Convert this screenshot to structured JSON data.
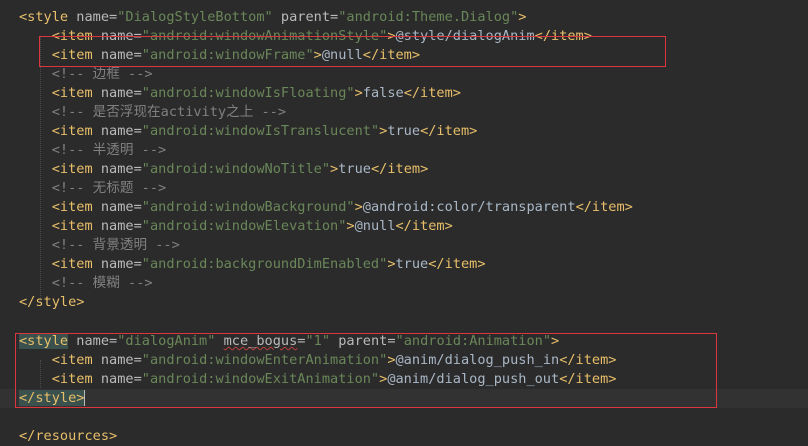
{
  "editor": {
    "lines": [
      {
        "segs": [
          [
            "tag",
            "<style "
          ],
          [
            "attr",
            "name="
          ],
          [
            "val",
            "\"DialogStyleBottom\""
          ],
          [
            "attr",
            " parent="
          ],
          [
            "val",
            "\"android:Theme.Dialog\""
          ],
          [
            "tag",
            ">"
          ]
        ]
      },
      {
        "segs": [
          [
            "ws",
            "    "
          ],
          [
            "tag",
            "<item "
          ],
          [
            "attr",
            "name="
          ],
          [
            "val",
            "\"android:windowAnimationStyle\""
          ],
          [
            "tag",
            ">"
          ],
          [
            "txt",
            "@style/dialogAnim"
          ],
          [
            "tag",
            "</item>"
          ]
        ]
      },
      {
        "segs": [
          [
            "ws",
            "    "
          ],
          [
            "tag",
            "<item "
          ],
          [
            "attr",
            "name="
          ],
          [
            "val",
            "\"android:windowFrame\""
          ],
          [
            "tag",
            ">"
          ],
          [
            "txt",
            "@null"
          ],
          [
            "tag",
            "</item>"
          ]
        ]
      },
      {
        "segs": [
          [
            "ws",
            "    "
          ],
          [
            "cmt",
            "<!-- 边框 -->"
          ]
        ]
      },
      {
        "segs": [
          [
            "ws",
            "    "
          ],
          [
            "tag",
            "<item "
          ],
          [
            "attr",
            "name="
          ],
          [
            "val",
            "\"android:windowIsFloating\""
          ],
          [
            "tag",
            ">"
          ],
          [
            "txt",
            "false"
          ],
          [
            "tag",
            "</item>"
          ]
        ]
      },
      {
        "segs": [
          [
            "ws",
            "    "
          ],
          [
            "cmt",
            "<!-- 是否浮现在activity之上 -->"
          ]
        ]
      },
      {
        "segs": [
          [
            "ws",
            "    "
          ],
          [
            "tag",
            "<item "
          ],
          [
            "attr",
            "name="
          ],
          [
            "val",
            "\"android:windowIsTranslucent\""
          ],
          [
            "tag",
            ">"
          ],
          [
            "txt",
            "true"
          ],
          [
            "tag",
            "</item>"
          ]
        ]
      },
      {
        "segs": [
          [
            "ws",
            "    "
          ],
          [
            "cmt",
            "<!-- 半透明 -->"
          ]
        ]
      },
      {
        "segs": [
          [
            "ws",
            "    "
          ],
          [
            "tag",
            "<item "
          ],
          [
            "attr",
            "name="
          ],
          [
            "val",
            "\"android:windowNoTitle\""
          ],
          [
            "tag",
            ">"
          ],
          [
            "txt",
            "true"
          ],
          [
            "tag",
            "</item>"
          ]
        ]
      },
      {
        "segs": [
          [
            "ws",
            "    "
          ],
          [
            "cmt",
            "<!-- 无标题 -->"
          ]
        ]
      },
      {
        "segs": [
          [
            "ws",
            "    "
          ],
          [
            "tag",
            "<item "
          ],
          [
            "attr",
            "name="
          ],
          [
            "val",
            "\"android:windowBackground\""
          ],
          [
            "tag",
            ">"
          ],
          [
            "txt",
            "@android:color/transparent"
          ],
          [
            "tag",
            "</item>"
          ]
        ]
      },
      {
        "segs": [
          [
            "ws",
            "    "
          ],
          [
            "tag",
            "<item "
          ],
          [
            "attr",
            "name="
          ],
          [
            "val",
            "\"android:windowElevation\""
          ],
          [
            "tag",
            ">"
          ],
          [
            "txt",
            "@null"
          ],
          [
            "tag",
            "</item>"
          ]
        ]
      },
      {
        "segs": [
          [
            "ws",
            "    "
          ],
          [
            "cmt",
            "<!-- 背景透明 -->"
          ]
        ]
      },
      {
        "segs": [
          [
            "ws",
            "    "
          ],
          [
            "tag",
            "<item "
          ],
          [
            "attr",
            "name="
          ],
          [
            "val",
            "\"android:backgroundDimEnabled\""
          ],
          [
            "tag",
            ">"
          ],
          [
            "txt",
            "true"
          ],
          [
            "tag",
            "</item>"
          ]
        ]
      },
      {
        "segs": [
          [
            "ws",
            "    "
          ],
          [
            "cmt",
            "<!-- 模糊 -->"
          ]
        ]
      },
      {
        "segs": [
          [
            "tag",
            "</style>"
          ]
        ]
      },
      {
        "segs": []
      },
      {
        "segs": [
          [
            "tagHL",
            "<style"
          ],
          [
            "tag",
            " "
          ],
          [
            "attr",
            "name="
          ],
          [
            "val",
            "\"dialogAnim\""
          ],
          [
            "attr",
            " "
          ],
          [
            "attrSq",
            "mce_bogus"
          ],
          [
            "attr",
            "="
          ],
          [
            "val",
            "\"1\""
          ],
          [
            "attr",
            " parent="
          ],
          [
            "val",
            "\"android:Animation\""
          ],
          [
            "tag",
            ">"
          ]
        ]
      },
      {
        "segs": [
          [
            "ws",
            "    "
          ],
          [
            "tag",
            "<item "
          ],
          [
            "attr",
            "name="
          ],
          [
            "val",
            "\"android:windowEnterAnimation\""
          ],
          [
            "tag",
            ">"
          ],
          [
            "txt",
            "@anim/dialog_push_in"
          ],
          [
            "tag",
            "</item>"
          ]
        ]
      },
      {
        "segs": [
          [
            "ws",
            "    "
          ],
          [
            "tag",
            "<item "
          ],
          [
            "attr",
            "name="
          ],
          [
            "val",
            "\"android:windowExitAnimation\""
          ],
          [
            "tag",
            ">"
          ],
          [
            "txt",
            "@anim/dialog_push_out"
          ],
          [
            "tag",
            "</item>"
          ]
        ]
      },
      {
        "segs": [
          [
            "tagHL",
            "</style"
          ],
          [
            "tagHL",
            ">"
          ]
        ],
        "current": true,
        "caret": true
      },
      {
        "segs": []
      },
      {
        "segs": [
          [
            "tag",
            "</resources>"
          ]
        ]
      }
    ]
  }
}
